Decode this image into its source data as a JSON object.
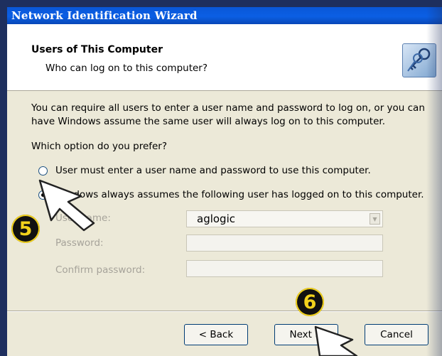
{
  "window": {
    "title": "Network Identification Wizard"
  },
  "header": {
    "title": "Users of This Computer",
    "subtitle": "Who can log on to this computer?",
    "icon": "keys-icon"
  },
  "body": {
    "description": "You can require all users to enter a user name and password to log on, or you can have Windows assume the same user will always log on to this computer.",
    "question": "Which option do you prefer?"
  },
  "options": [
    {
      "label": "User must enter a user name and password to use this computer.",
      "selected": false
    },
    {
      "label": "Windows always assumes the following user has logged on to this computer.",
      "selected": true
    }
  ],
  "fields": {
    "username_label": "User name:",
    "username_value": "aglogic",
    "password_label": "Password:",
    "confirm_label": "Confirm password:"
  },
  "buttons": {
    "back": "< Back",
    "next": "Next >",
    "cancel": "Cancel"
  },
  "annotations": {
    "step5": "5",
    "step6": "6",
    "badge_color": "#f2d21c"
  }
}
